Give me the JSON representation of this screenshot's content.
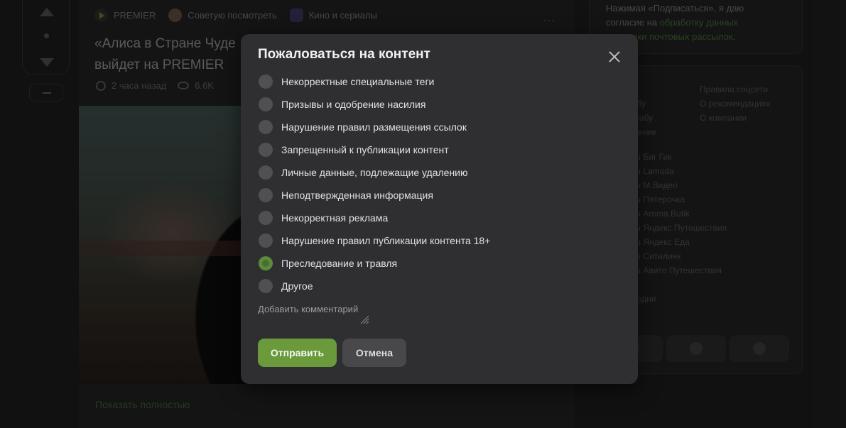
{
  "story": {
    "meta": {
      "community": "PREMIER",
      "author": "Советую посмотреть",
      "tag": "Кино и сериалы",
      "more": "..."
    },
    "title_line1": "«Алиса в Стране Чуде",
    "title_line2": "выйдет на PREMIER",
    "time": "2 часа назад",
    "views": "6.6K",
    "show_more": "Показать полностью"
  },
  "sidebar": {
    "subscribe_pre": "Нажимая «Подписаться», я даю согласие на ",
    "subscribe_link1": "обработку данных",
    "subscribe_link2": "рассылки почтовых рассылок",
    "links_col_a": [
      "о",
      "Пикабу",
      "а Пикабу",
      "иложение"
    ],
    "links_col_b": [
      "Правила соцсети",
      "О рекомендациях",
      "О компании"
    ],
    "promo": [
      "оды Биг Гик",
      "оды Lamoda",
      "оды М.Видео",
      "оды Пятерочка",
      "оды Aroma Butik",
      "оды Яндекс Путешествия",
      "оды Яндекс Еда",
      "оды Ситилинк",
      "оды Авито Путешествия",
      "",
      "сегодня"
    ],
    "social_icons": [
      "vk-icon",
      "telegram-icon",
      "dzen-icon"
    ]
  },
  "modal": {
    "title": "Пожаловаться на контент",
    "reasons": [
      {
        "label": "Некорректные специальные теги",
        "checked": false
      },
      {
        "label": "Призывы и одобрение насилия",
        "checked": false
      },
      {
        "label": "Нарушение правил размещения ссылок",
        "checked": false
      },
      {
        "label": "Запрещенный к публикации контент",
        "checked": false
      },
      {
        "label": "Личные данные, подлежащие удалению",
        "checked": false
      },
      {
        "label": "Неподтвержденная информация",
        "checked": false
      },
      {
        "label": "Некорректная реклама",
        "checked": false
      },
      {
        "label": "Нарушение правил публикации контента 18+",
        "checked": false
      },
      {
        "label": "Преследование и травля",
        "checked": true
      },
      {
        "label": "Другое",
        "checked": false
      }
    ],
    "comment_placeholder": "Добавить комментарий",
    "submit_label": "Отправить",
    "cancel_label": "Отмена"
  },
  "colors": {
    "accent_green": "#6a9a3c",
    "modal_bg": "#2f2f31",
    "page_bg": "#1b1b1c"
  }
}
